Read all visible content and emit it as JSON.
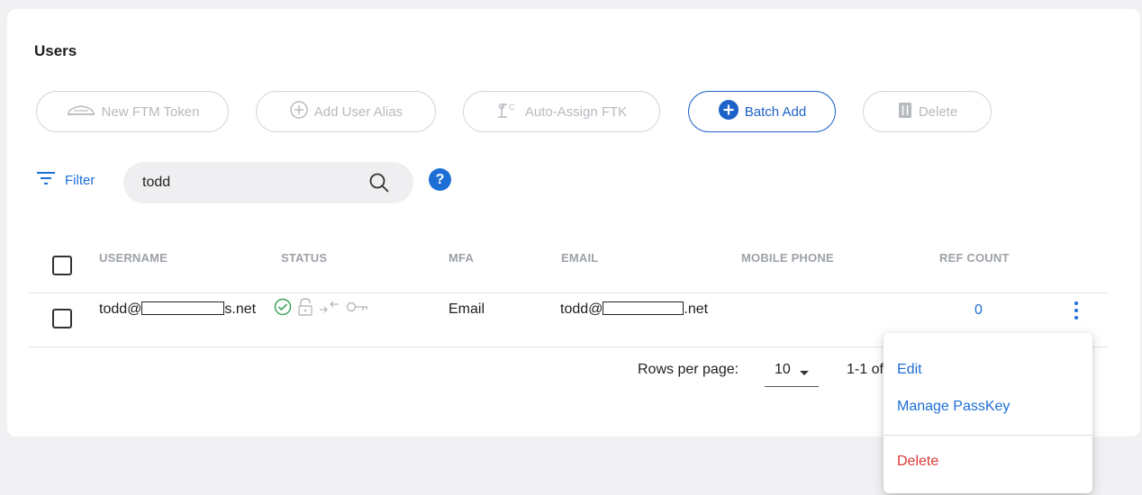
{
  "panel": {
    "title": "Users"
  },
  "toolbar": {
    "new_ftm_token": "New FTM Token",
    "add_user_alias": "Add User Alias",
    "auto_assign_ftk": "Auto-Assign FTK",
    "batch_add": "Batch Add",
    "delete": "Delete"
  },
  "filter": {
    "label": "Filter",
    "search_value": "todd",
    "help": "?"
  },
  "table": {
    "headers": [
      "USERNAME",
      "STATUS",
      "MFA",
      "EMAIL",
      "MOBILE PHONE",
      "REF COUNT"
    ],
    "rows": [
      {
        "username_prefix": "todd@",
        "username_suffix": "s.net",
        "status_icons": [
          "check-circle-icon",
          "lock-open-icon",
          "arrows-icon",
          "key-icon"
        ],
        "mfa": "Email",
        "email_prefix": "todd@",
        "email_suffix": ".net",
        "mobile_phone": "",
        "ref_count": "0"
      }
    ]
  },
  "pagination": {
    "rows_per_page_label": "Rows per page:",
    "rows_per_page_value": "10",
    "range": "1-1 of"
  },
  "context_menu": {
    "edit": "Edit",
    "manage_passkey": "Manage PassKey",
    "delete": "Delete"
  },
  "colors": {
    "accent": "#1d6fd6",
    "primary_border": "#1d62c7",
    "danger": "#d93a3a",
    "success": "#3aa35a"
  }
}
